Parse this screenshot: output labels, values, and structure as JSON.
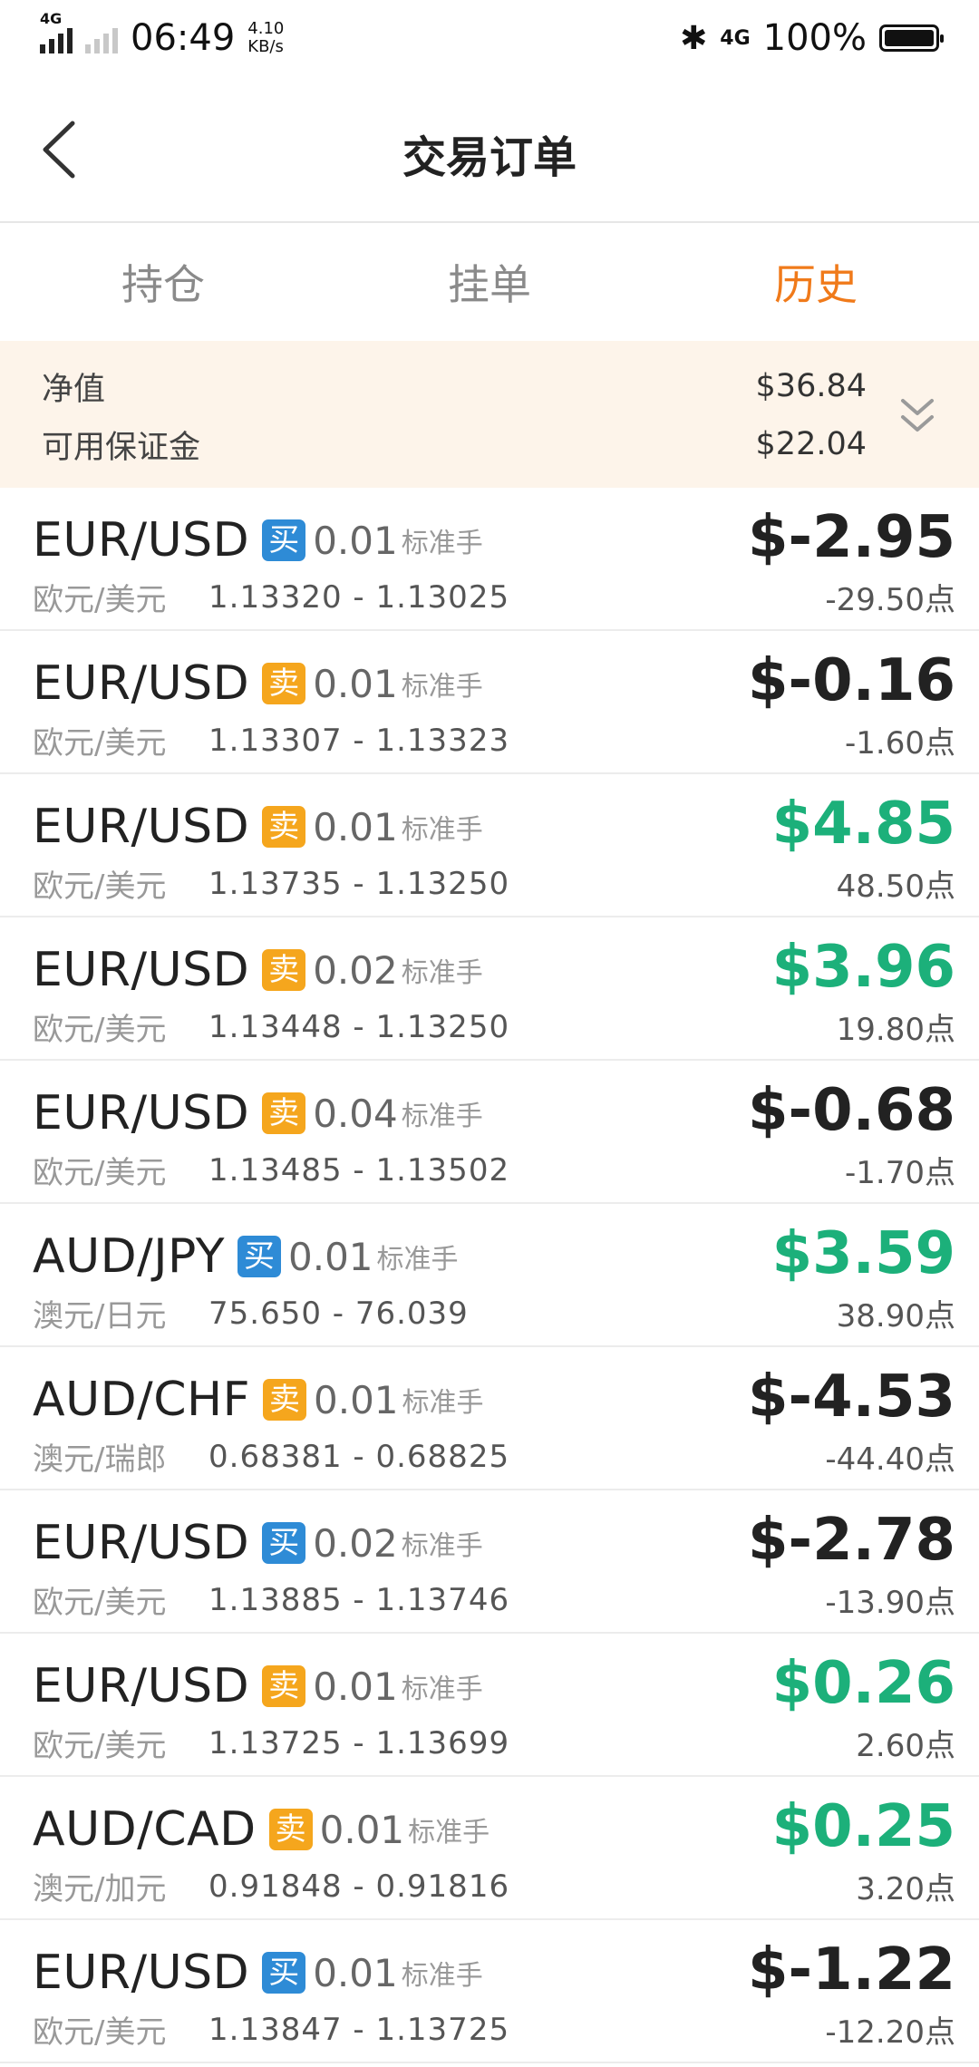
{
  "status_bar": {
    "network": "4G",
    "time": "06:49",
    "speed_value": "4.10",
    "speed_unit": "KB/s",
    "bluetooth": "bluetooth-icon",
    "network_right": "4G",
    "battery": "100%"
  },
  "header": {
    "title": "交易订单"
  },
  "tabs": [
    {
      "label": "持仓",
      "active": false
    },
    {
      "label": "挂单",
      "active": false
    },
    {
      "label": "历史",
      "active": true
    }
  ],
  "summary": {
    "equity_label": "净值",
    "equity_value": "$36.84",
    "margin_label": "可用保证金",
    "margin_value": "$22.04"
  },
  "colors": {
    "accent": "#f07a1a",
    "buy": "#2e8bd6",
    "sell": "#f5a61d",
    "profit": "#1cb07a",
    "loss": "#222222"
  },
  "orders": [
    {
      "symbol": "EUR/USD",
      "side": "买",
      "type": "buy",
      "lots": "0.01",
      "unit": "标准手",
      "name": "欧元/美元",
      "prices": "1.13320 - 1.13025",
      "pnl": "$-2.95",
      "points": "-29.50点",
      "profit": false
    },
    {
      "symbol": "EUR/USD",
      "side": "卖",
      "type": "sell",
      "lots": "0.01",
      "unit": "标准手",
      "name": "欧元/美元",
      "prices": "1.13307 - 1.13323",
      "pnl": "$-0.16",
      "points": "-1.60点",
      "profit": false
    },
    {
      "symbol": "EUR/USD",
      "side": "卖",
      "type": "sell",
      "lots": "0.01",
      "unit": "标准手",
      "name": "欧元/美元",
      "prices": "1.13735 - 1.13250",
      "pnl": "$4.85",
      "points": "48.50点",
      "profit": true
    },
    {
      "symbol": "EUR/USD",
      "side": "卖",
      "type": "sell",
      "lots": "0.02",
      "unit": "标准手",
      "name": "欧元/美元",
      "prices": "1.13448 - 1.13250",
      "pnl": "$3.96",
      "points": "19.80点",
      "profit": true
    },
    {
      "symbol": "EUR/USD",
      "side": "卖",
      "type": "sell",
      "lots": "0.04",
      "unit": "标准手",
      "name": "欧元/美元",
      "prices": "1.13485 - 1.13502",
      "pnl": "$-0.68",
      "points": "-1.70点",
      "profit": false
    },
    {
      "symbol": "AUD/JPY",
      "side": "买",
      "type": "buy",
      "lots": "0.01",
      "unit": "标准手",
      "name": "澳元/日元",
      "prices": "75.650 - 76.039",
      "pnl": "$3.59",
      "points": "38.90点",
      "profit": true
    },
    {
      "symbol": "AUD/CHF",
      "side": "卖",
      "type": "sell",
      "lots": "0.01",
      "unit": "标准手",
      "name": "澳元/瑞郎",
      "prices": "0.68381 - 0.68825",
      "pnl": "$-4.53",
      "points": "-44.40点",
      "profit": false
    },
    {
      "symbol": "EUR/USD",
      "side": "买",
      "type": "buy",
      "lots": "0.02",
      "unit": "标准手",
      "name": "欧元/美元",
      "prices": "1.13885 - 1.13746",
      "pnl": "$-2.78",
      "points": "-13.90点",
      "profit": false
    },
    {
      "symbol": "EUR/USD",
      "side": "卖",
      "type": "sell",
      "lots": "0.01",
      "unit": "标准手",
      "name": "欧元/美元",
      "prices": "1.13725 - 1.13699",
      "pnl": "$0.26",
      "points": "2.60点",
      "profit": true
    },
    {
      "symbol": "AUD/CAD",
      "side": "卖",
      "type": "sell",
      "lots": "0.01",
      "unit": "标准手",
      "name": "澳元/加元",
      "prices": "0.91848 - 0.91816",
      "pnl": "$0.25",
      "points": "3.20点",
      "profit": true
    },
    {
      "symbol": "EUR/USD",
      "side": "买",
      "type": "buy",
      "lots": "0.01",
      "unit": "标准手",
      "name": "欧元/美元",
      "prices": "1.13847 - 1.13725",
      "pnl": "$-1.22",
      "points": "-12.20点",
      "profit": false
    }
  ]
}
